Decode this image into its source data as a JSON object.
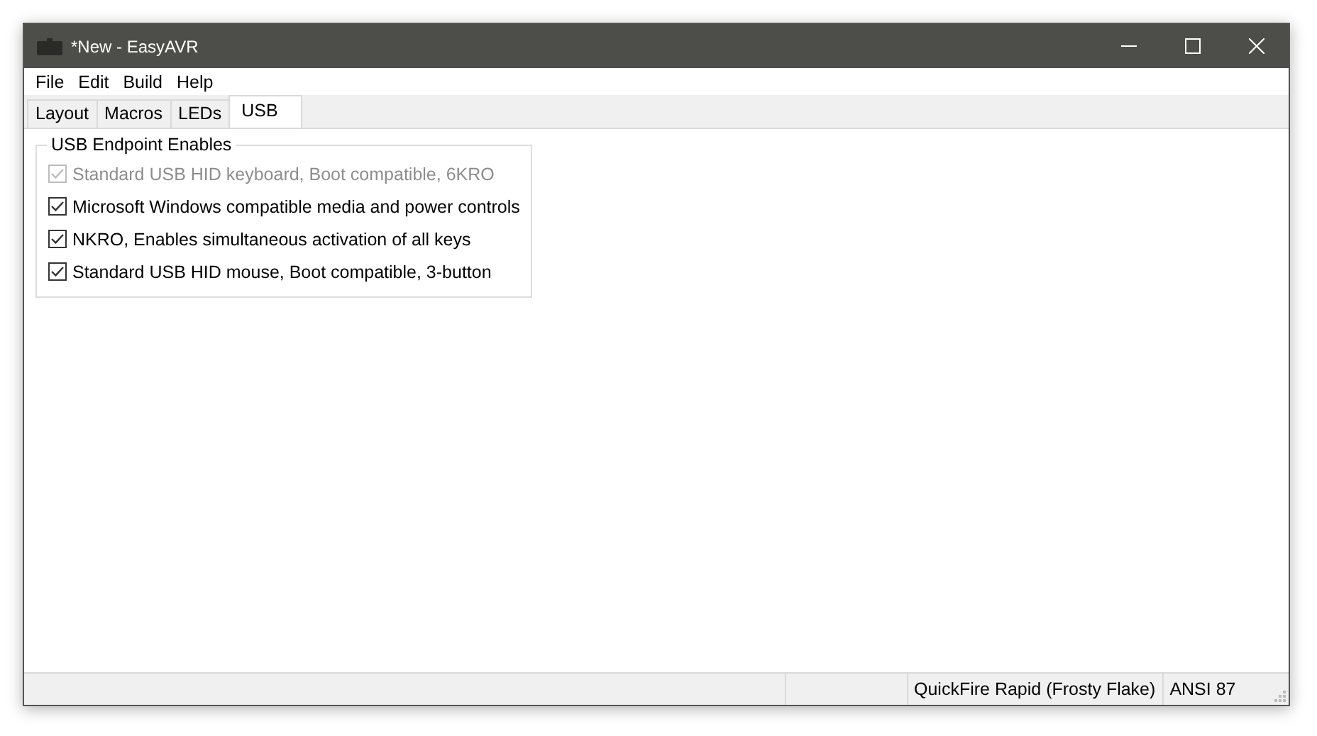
{
  "window": {
    "title": "*New - EasyAVR"
  },
  "menu": [
    "File",
    "Edit",
    "Build",
    "Help"
  ],
  "tabs": [
    {
      "label": "Layout",
      "selected": false
    },
    {
      "label": "Macros",
      "selected": false
    },
    {
      "label": "LEDs",
      "selected": false
    },
    {
      "label": "USB",
      "selected": true
    }
  ],
  "group": {
    "title": "USB Endpoint Enables",
    "options": [
      {
        "label": "Standard USB HID keyboard, Boot compatible, 6KRO",
        "checked": true,
        "disabled": true
      },
      {
        "label": "Microsoft Windows compatible media and power controls",
        "checked": true,
        "disabled": false
      },
      {
        "label": "NKRO, Enables simultaneous activation of all keys",
        "checked": true,
        "disabled": false
      },
      {
        "label": "Standard USB HID mouse, Boot compatible, 3-button",
        "checked": true,
        "disabled": false
      }
    ]
  },
  "status_bar": {
    "panes": [
      "QuickFire Rapid (Frosty Flake)",
      "ANSI 87"
    ]
  }
}
